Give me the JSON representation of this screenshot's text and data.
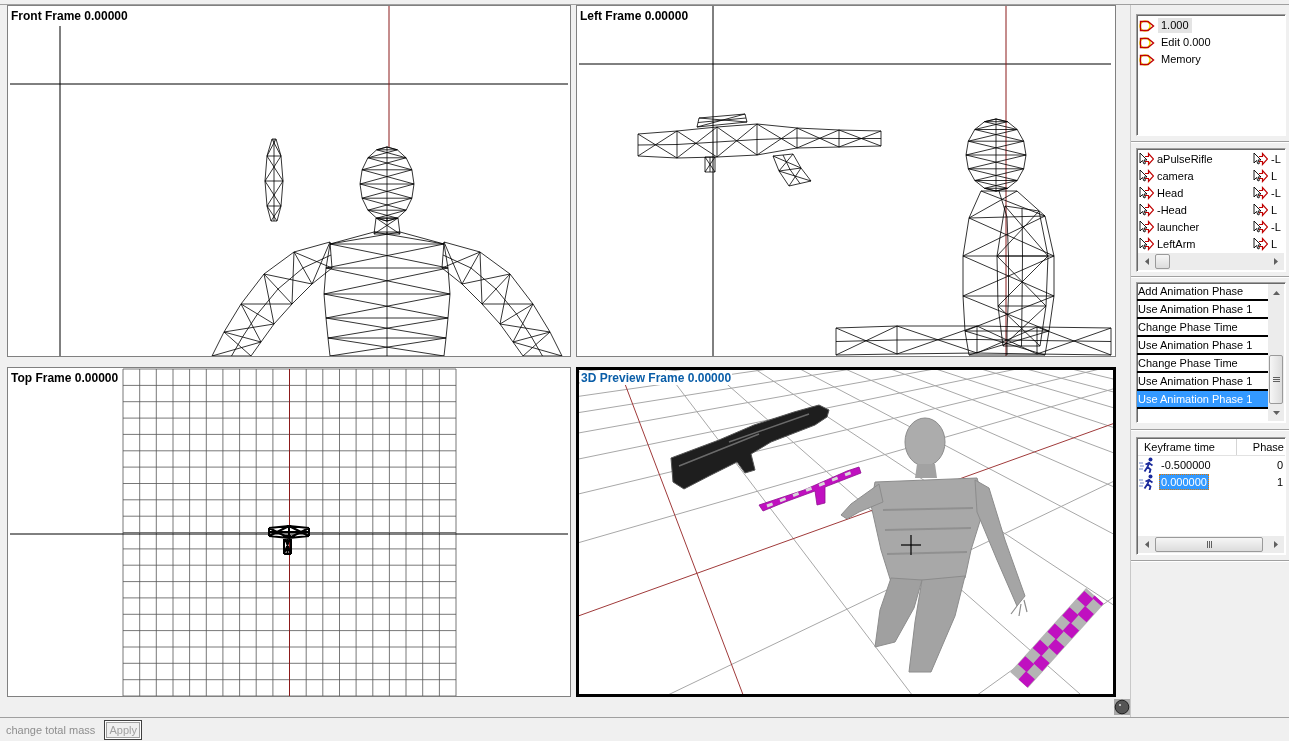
{
  "viewports": [
    {
      "title": "Front Frame 0.00000",
      "kind": "front",
      "active": false
    },
    {
      "title": "Left Frame 0.00000",
      "kind": "left",
      "active": false
    },
    {
      "title": "Top Frame 0.00000",
      "kind": "top",
      "active": false
    },
    {
      "title": "3D Preview Frame 0.00000",
      "kind": "preview",
      "active": true
    }
  ],
  "state_list": {
    "items": [
      {
        "label": "1.000",
        "selected": true
      },
      {
        "label": "Edit 0.000",
        "selected": false
      },
      {
        "label": "Memory",
        "selected": false
      }
    ]
  },
  "node_list": {
    "items": [
      "aPulseRifle",
      "camera",
      "Head",
      "-Head",
      "launcher",
      "LeftArm",
      "-L",
      "L",
      "-L",
      "L",
      "-L",
      "L"
    ]
  },
  "action_list": {
    "items": [
      {
        "label": "Add Animation Phase",
        "selected": false
      },
      {
        "label": "Use Animation Phase 1",
        "selected": false
      },
      {
        "label": "Change Phase Time",
        "selected": false
      },
      {
        "label": "Use Animation Phase 1",
        "selected": false
      },
      {
        "label": "Change Phase Time",
        "selected": false
      },
      {
        "label": "Use Animation Phase 1",
        "selected": false
      },
      {
        "label": "Use Animation Phase 1",
        "selected": true
      }
    ]
  },
  "keyframes": {
    "columns": [
      "Keyframe time",
      "Phase"
    ],
    "rows": [
      {
        "time": "-0.500000",
        "phase": "0",
        "selected": false
      },
      {
        "time": "0.000000",
        "phase": "1",
        "selected": true
      }
    ]
  },
  "footer": {
    "label": "change total mass",
    "button": "Apply",
    "disabled": true
  }
}
